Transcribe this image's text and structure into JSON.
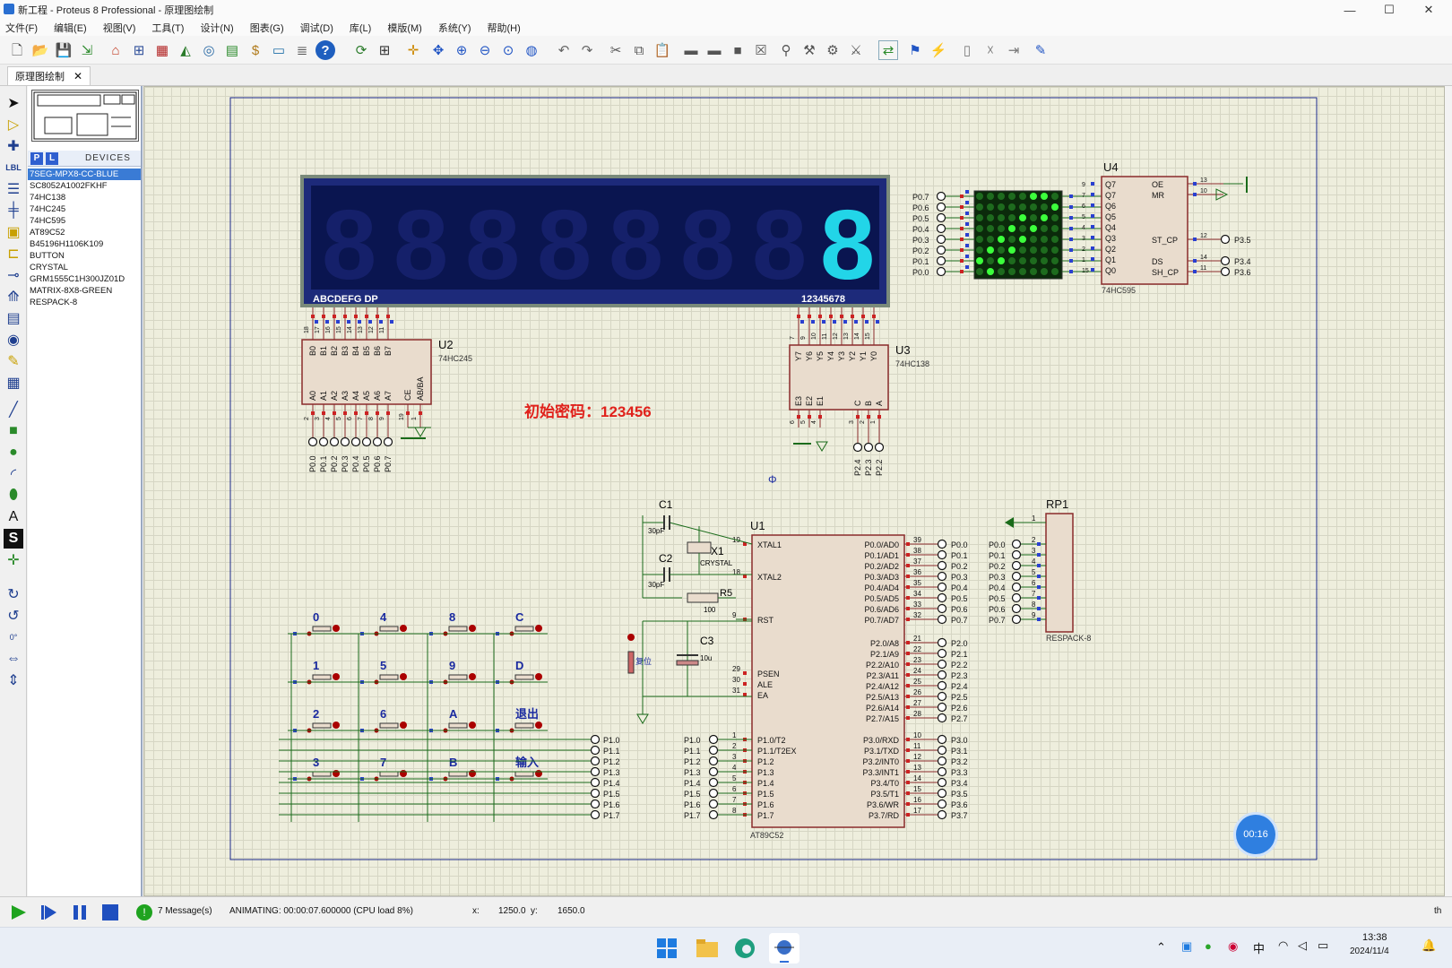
{
  "window": {
    "title": "新工程 - Proteus 8 Professional - 原理图绘制",
    "controls": [
      "—",
      "☐",
      "✕"
    ]
  },
  "menu": [
    "文件(F)",
    "编辑(E)",
    "视图(V)",
    "工具(T)",
    "设计(N)",
    "图表(G)",
    "调试(D)",
    "库(L)",
    "模版(M)",
    "系统(Y)",
    "帮助(H)"
  ],
  "tab": {
    "label": "原理图绘制",
    "close": "✕"
  },
  "devices": {
    "header_p": "P",
    "header_l": "L",
    "header_label": "DEVICES",
    "items": [
      "7SEG-MPX8-CC-BLUE",
      "SC8052A1002FKHF",
      "74HC138",
      "74HC245",
      "74HC595",
      "AT89C52",
      "B45196H1106K109",
      "BUTTON",
      "CRYSTAL",
      "GRM1555C1H300JZ01D",
      "MATRIX-8X8-GREEN",
      "RESPACK-8"
    ],
    "selected": 0
  },
  "schematic": {
    "display": {
      "segment_label": "ABCDEFG  DP",
      "digit_label": "12345678",
      "shown_digit": "8"
    },
    "u2": {
      "ref": "U2",
      "part": "74HC245",
      "b_pins": [
        "B0",
        "B1",
        "B2",
        "B3",
        "B4",
        "B5",
        "B6",
        "B7"
      ],
      "a_pins": [
        "A0",
        "A1",
        "A2",
        "A3",
        "A4",
        "A5",
        "A6",
        "A7"
      ],
      "ctl_pins": [
        "CE",
        "AB/BA"
      ],
      "top_nums": [
        "18",
        "17",
        "16",
        "15",
        "14",
        "13",
        "12",
        "11"
      ],
      "bottom_nums": [
        "2",
        "3",
        "4",
        "5",
        "6",
        "7",
        "8",
        "9",
        "19",
        "1"
      ],
      "net_labels": [
        "P0.0",
        "P0.1",
        "P0.2",
        "P0.3",
        "P0.4",
        "P0.5",
        "P0.6",
        "P0.7"
      ]
    },
    "u3": {
      "ref": "U3",
      "part": "74HC138",
      "y_pins": [
        "Y7",
        "Y6",
        "Y5",
        "Y4",
        "Y3",
        "Y2",
        "Y1",
        "Y0"
      ],
      "en_pins": [
        "E3",
        "E2",
        "E1"
      ],
      "sel_pins": [
        "C",
        "B",
        "A"
      ],
      "top_nums": [
        "7",
        "9",
        "10",
        "11",
        "12",
        "13",
        "14",
        "15"
      ],
      "bottom_nums": [
        "6",
        "5",
        "4",
        "3",
        "2",
        "1"
      ],
      "net_labels": [
        "P2.4",
        "P2.3",
        "P2.2"
      ]
    },
    "u4": {
      "ref": "U4",
      "part": "74HC595",
      "q_pins": [
        "Q7",
        "Q7",
        "Q6",
        "Q5",
        "Q4",
        "Q3",
        "Q2",
        "Q1",
        "Q0"
      ],
      "right_pins": [
        "OE",
        "MR",
        "ST_CP",
        "DS",
        "SH_CP"
      ],
      "left_nums": [
        "9",
        "7",
        "6",
        "5",
        "4",
        "3",
        "2",
        "1",
        "15"
      ],
      "right_nums": [
        "13",
        "10",
        "12",
        "14",
        "11"
      ],
      "nets_right": [
        "P3.5",
        "P3.4",
        "P3.6"
      ]
    },
    "matrix_labels": [
      "P0.7",
      "P0.6",
      "P0.5",
      "P0.4",
      "P0.3",
      "P0.2",
      "P0.1",
      "P0.0"
    ],
    "password_note": "初始密码：123456",
    "u1": {
      "ref": "U1",
      "part": "AT89C52",
      "left_pins": [
        "XTAL1",
        "XTAL2",
        "RST",
        "PSEN",
        "ALE",
        "EA",
        "P1.0/T2",
        "P1.1/T2EX",
        "P1.2",
        "P1.3",
        "P1.4",
        "P1.5",
        "P1.6",
        "P1.7"
      ],
      "left_nums": [
        "19",
        "18",
        "9",
        "29",
        "30",
        "31",
        "1",
        "2",
        "3",
        "4",
        "5",
        "6",
        "7",
        "8"
      ],
      "right_pins_p0": [
        "P0.0/AD0",
        "P0.1/AD1",
        "P0.2/AD2",
        "P0.3/AD3",
        "P0.4/AD4",
        "P0.5/AD5",
        "P0.6/AD6",
        "P0.7/AD7"
      ],
      "right_nums_p0": [
        "39",
        "38",
        "37",
        "36",
        "35",
        "34",
        "33",
        "32"
      ],
      "right_pins_p2": [
        "P2.0/A8",
        "P2.1/A9",
        "P2.2/A10",
        "P2.3/A11",
        "P2.4/A12",
        "P2.5/A13",
        "P2.6/A14",
        "P2.7/A15"
      ],
      "right_nums_p2": [
        "21",
        "22",
        "23",
        "24",
        "25",
        "26",
        "27",
        "28"
      ],
      "right_pins_p3": [
        "P3.0/RXD",
        "P3.1/TXD",
        "P3.2/INT0",
        "P3.3/INT1",
        "P3.4/T0",
        "P3.5/T1",
        "P3.6/WR",
        "P3.7/RD"
      ],
      "right_nums_p3": [
        "10",
        "11",
        "12",
        "13",
        "14",
        "15",
        "16",
        "17"
      ],
      "nets_p0": [
        "P0.0",
        "P0.1",
        "P0.2",
        "P0.3",
        "P0.4",
        "P0.5",
        "P0.6",
        "P0.7"
      ],
      "nets_p2": [
        "P2.0",
        "P2.1",
        "P2.2",
        "P2.3",
        "P2.4",
        "P2.5",
        "P2.6",
        "P2.7"
      ],
      "nets_p3": [
        "P3.0",
        "P3.1",
        "P3.2",
        "P3.3",
        "P3.4",
        "P3.5",
        "P3.6",
        "P3.7"
      ],
      "nets_p1": [
        "P1.0",
        "P1.1",
        "P1.2",
        "P1.3",
        "P1.4",
        "P1.5",
        "P1.6",
        "P1.7"
      ]
    },
    "rp1": {
      "ref": "RP1",
      "part": "RESPACK-8",
      "nums": [
        "1",
        "2",
        "3",
        "4",
        "5",
        "6",
        "7",
        "8",
        "9"
      ],
      "nets": [
        "P0.0",
        "P0.1",
        "P0.2",
        "P0.3",
        "P0.4",
        "P0.5",
        "P0.6",
        "P0.7"
      ]
    },
    "passives": {
      "c1": "C1",
      "c1_val": "30pF",
      "c2": "C2",
      "c2_val": "30pF",
      "x1": "X1",
      "x1_val": "CRYSTAL",
      "r5": "R5",
      "r5_val": "100",
      "c3": "C3",
      "c3_val": "10u",
      "reset": "复位",
      "phi": "Φ"
    },
    "keypad": {
      "col_labels": [
        "0",
        "4",
        "8",
        "C"
      ],
      "rows": [
        [
          "0",
          "4",
          "8",
          "C"
        ],
        [
          "1",
          "5",
          "9",
          "D"
        ],
        [
          "2",
          "6",
          "A",
          "退出"
        ],
        [
          "3",
          "7",
          "B",
          "输入"
        ]
      ],
      "nets": [
        "P1.0",
        "P1.1",
        "P1.2",
        "P1.3",
        "P1.4",
        "P1.5",
        "P1.6",
        "P1.7"
      ]
    },
    "timer_badge": "00:16"
  },
  "status": {
    "messages": "7 Message(s)",
    "animating": "ANIMATING: 00:00:07.600000 (CPU load 8%)",
    "x_label": "x:",
    "x_val": "1250.0",
    "y_label": "y:",
    "y_val": "1650.0",
    "th": "th"
  },
  "taskbar": {
    "time": "13:38",
    "date": "2024/11/4",
    "ime": "中"
  }
}
